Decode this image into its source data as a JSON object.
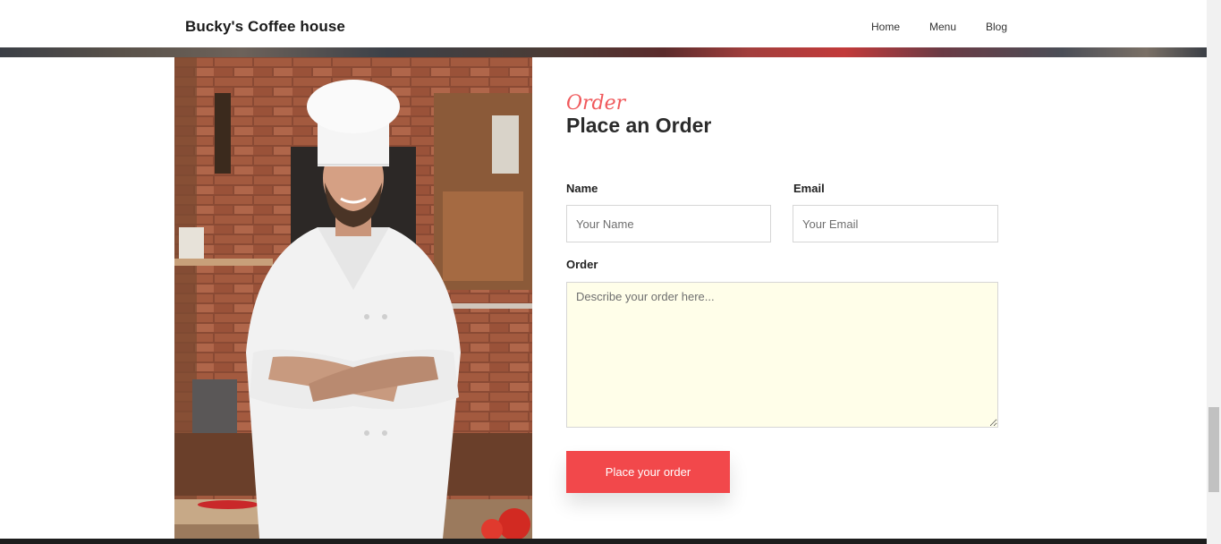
{
  "header": {
    "brand": "Bucky's Coffee house",
    "nav": [
      {
        "label": "Home"
      },
      {
        "label": "Menu"
      },
      {
        "label": "Blog"
      }
    ]
  },
  "order_section": {
    "eyebrow": "Order",
    "title": "Place an Order",
    "name_label": "Name",
    "name_placeholder": "Your Name",
    "email_label": "Email",
    "email_placeholder": "Your Email",
    "order_label": "Order",
    "order_placeholder": "Describe your order here...",
    "submit_label": "Place your order"
  },
  "colors": {
    "accent": "#f2484b",
    "eyebrow": "#f0595c",
    "textarea_bg": "#fffee9"
  },
  "icons": {
    "photo": "chef-photo"
  }
}
